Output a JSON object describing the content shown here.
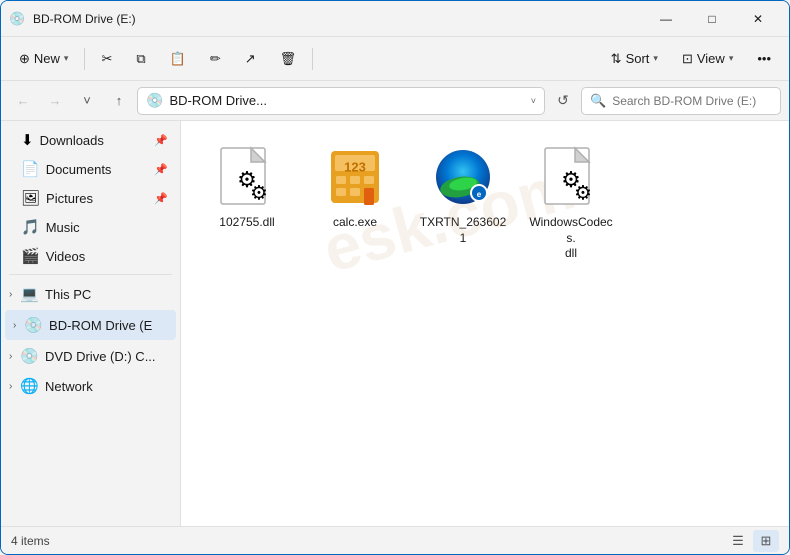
{
  "window": {
    "title": "BD-ROM Drive (E:)",
    "icon": "💿"
  },
  "titlebar_controls": {
    "minimize": "—",
    "maximize": "□",
    "close": "✕"
  },
  "toolbar": {
    "new_label": "New",
    "sort_label": "Sort",
    "view_label": "View",
    "more_label": "•••",
    "cut_icon": "✂",
    "copy_icon": "⧉",
    "paste_icon": "📋",
    "rename_icon": "✏",
    "share_icon": "↗",
    "delete_icon": "🗑"
  },
  "addressbar": {
    "back_icon": "←",
    "forward_icon": "→",
    "up_dropdown": "˅",
    "up_icon": "↑",
    "address_icon": "💿",
    "address_text": "BD-ROM Drive...",
    "address_chevron": "˅",
    "refresh_icon": "↺",
    "search_placeholder": "Search BD-ROM Drive (E:)"
  },
  "sidebar": {
    "sections": [
      {
        "label": "Downloads",
        "icon": "⬇",
        "pinned": true,
        "id": "downloads"
      },
      {
        "label": "Documents",
        "icon": "📄",
        "pinned": true,
        "id": "documents"
      },
      {
        "label": "Pictures",
        "icon": "🖼",
        "pinned": true,
        "id": "pictures"
      },
      {
        "label": "Music",
        "icon": "🎵",
        "pinned": false,
        "id": "music"
      },
      {
        "label": "Videos",
        "icon": "🎬",
        "pinned": false,
        "id": "videos"
      }
    ],
    "tree_items": [
      {
        "label": "This PC",
        "icon": "💻",
        "id": "this-pc"
      },
      {
        "label": "BD-ROM Drive (E",
        "icon": "💿",
        "id": "bdrom",
        "active": true
      },
      {
        "label": "DVD Drive (D:) C...",
        "icon": "💿",
        "id": "dvd"
      },
      {
        "label": "Network",
        "icon": "🌐",
        "id": "network"
      }
    ]
  },
  "files": [
    {
      "name": "102755.dll",
      "type": "dll",
      "id": "file-dll1"
    },
    {
      "name": "calc.exe",
      "type": "calc",
      "id": "file-calc"
    },
    {
      "name": "TXRTN_2636021",
      "type": "edge",
      "id": "file-edge"
    },
    {
      "name": "WindowsCodecs.\ndll",
      "type": "dll2",
      "id": "file-dll2"
    }
  ],
  "statusbar": {
    "items_count": "4 items",
    "list_view_icon": "☰",
    "grid_view_icon": "⊞"
  }
}
